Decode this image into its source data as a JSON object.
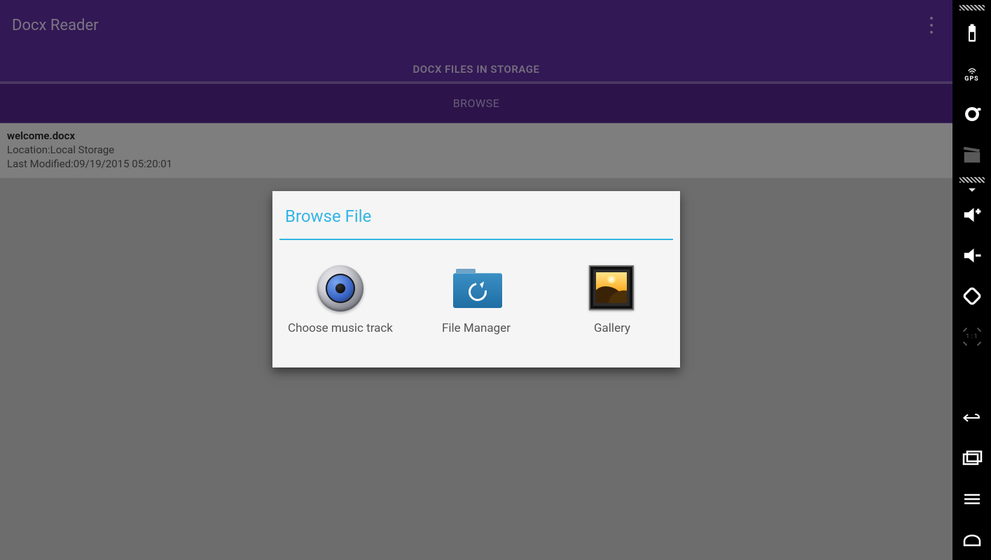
{
  "header": {
    "app_title": "Docx Reader",
    "tab_label": "DOCX FILES IN STORAGE"
  },
  "browse_button_label": "BROWSE",
  "files": [
    {
      "name": "welcome.docx",
      "location_line": "Location:Local Storage",
      "modified_line": "Last Modified:09/19/2015 05:20:01"
    }
  ],
  "dialog": {
    "title": "Browse File",
    "options": [
      {
        "id": "choose-music-track",
        "label": "Choose music track"
      },
      {
        "id": "file-manager",
        "label": "File Manager"
      },
      {
        "id": "gallery",
        "label": "Gallery"
      }
    ]
  },
  "sidebar": {
    "items": [
      {
        "id": "battery",
        "name": "battery-icon",
        "interactable": true
      },
      {
        "id": "gps",
        "name": "gps-icon",
        "interactable": true
      },
      {
        "id": "camera",
        "name": "camera-icon",
        "interactable": true
      },
      {
        "id": "clapper",
        "name": "clapperboard-icon",
        "interactable": false
      },
      {
        "id": "volume-up",
        "name": "volume-up-icon",
        "interactable": true
      },
      {
        "id": "volume-down",
        "name": "volume-down-icon",
        "interactable": true
      },
      {
        "id": "rotate",
        "name": "rotate-icon",
        "interactable": true
      },
      {
        "id": "scale-1-1",
        "name": "scale-1-1-icon",
        "interactable": false
      },
      {
        "id": "back",
        "name": "back-icon",
        "interactable": true
      },
      {
        "id": "recents",
        "name": "recents-icon",
        "interactable": true
      },
      {
        "id": "menu",
        "name": "menu-icon",
        "interactable": true
      },
      {
        "id": "home",
        "name": "home-icon",
        "interactable": true
      }
    ],
    "scale_label": "1 : 1",
    "gps_label": "GPS"
  }
}
